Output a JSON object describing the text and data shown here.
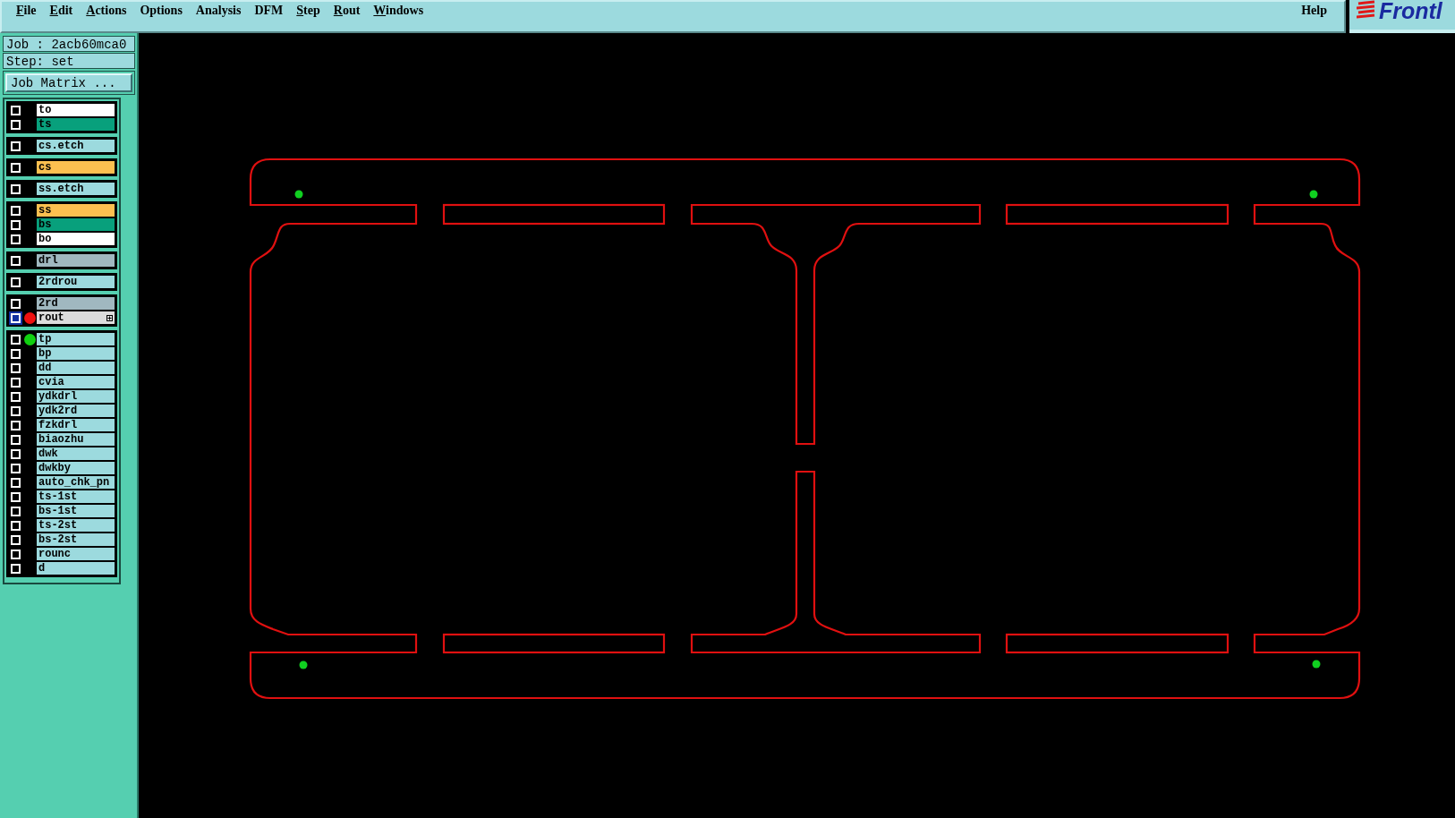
{
  "menu_bar": {
    "items": [
      {
        "label": "File",
        "mnemonic": true
      },
      {
        "label": "Edit",
        "mnemonic": true
      },
      {
        "label": "Actions",
        "mnemonic": true
      },
      {
        "label": "Options",
        "mnemonic": false
      },
      {
        "label": "Analysis",
        "mnemonic": false
      },
      {
        "label": "DFM",
        "mnemonic": false
      },
      {
        "label": "Step",
        "mnemonic": true
      },
      {
        "label": "Rout",
        "mnemonic": true
      },
      {
        "label": "Windows",
        "mnemonic": true
      }
    ],
    "help": "Help",
    "logo": "Frontl"
  },
  "job_panel": {
    "job": "Job : 2acb60mca0",
    "step": "Step: set",
    "job_matrix_button": "Job Matrix ..."
  },
  "layer_groups": [
    {
      "layers": [
        {
          "name": "to",
          "color": "#ffffff",
          "selected": false,
          "work_layer": false,
          "affected": false
        },
        {
          "name": "ts",
          "color": "#08a07c",
          "selected": false,
          "work_layer": false,
          "affected": false
        }
      ]
    },
    {
      "layers": [
        {
          "name": "cs.etch",
          "color": "#9cdade",
          "selected": false,
          "work_layer": false,
          "affected": false
        }
      ]
    },
    {
      "layers": [
        {
          "name": "cs",
          "color": "#fcc050",
          "selected": false,
          "work_layer": false,
          "affected": false
        }
      ]
    },
    {
      "layers": [
        {
          "name": "ss.etch",
          "color": "#9cdade",
          "selected": false,
          "work_layer": false,
          "affected": false
        }
      ]
    },
    {
      "layers": [
        {
          "name": "ss",
          "color": "#fcc050",
          "selected": false,
          "work_layer": false,
          "affected": false
        },
        {
          "name": "bs",
          "color": "#08a07c",
          "selected": false,
          "work_layer": false,
          "affected": false
        },
        {
          "name": "bo",
          "color": "#ffffff",
          "selected": false,
          "work_layer": false,
          "affected": false
        }
      ]
    },
    {
      "layers": [
        {
          "name": "drl",
          "color": "#a0b8c0",
          "selected": false,
          "work_layer": false,
          "affected": false
        }
      ]
    },
    {
      "layers": [
        {
          "name": "2rdrou",
          "color": "#9cdade",
          "selected": false,
          "work_layer": false,
          "affected": false
        }
      ]
    },
    {
      "layers": [
        {
          "name": "2rd",
          "color": "#a0b8c0",
          "selected": false,
          "work_layer": false,
          "affected": false
        },
        {
          "name": "rout",
          "color": "#dcdcdc",
          "selected": true,
          "work_layer": true,
          "affected": false
        }
      ]
    },
    {
      "layers": [
        {
          "name": "tp",
          "color": "#9cdade",
          "selected": false,
          "work_layer": false,
          "affected": true
        },
        {
          "name": "bp",
          "color": "#9cdade",
          "selected": false,
          "work_layer": false,
          "affected": false
        },
        {
          "name": "dd",
          "color": "#9cdade",
          "selected": false,
          "work_layer": false,
          "affected": false
        },
        {
          "name": "cvia",
          "color": "#9cdade",
          "selected": false,
          "work_layer": false,
          "affected": false
        },
        {
          "name": "ydkdrl",
          "color": "#9cdade",
          "selected": false,
          "work_layer": false,
          "affected": false
        },
        {
          "name": "ydk2rd",
          "color": "#9cdade",
          "selected": false,
          "work_layer": false,
          "affected": false
        },
        {
          "name": "fzkdrl",
          "color": "#9cdade",
          "selected": false,
          "work_layer": false,
          "affected": false
        },
        {
          "name": "biaozhu",
          "color": "#9cdade",
          "selected": false,
          "work_layer": false,
          "affected": false
        },
        {
          "name": "dwk",
          "color": "#9cdade",
          "selected": false,
          "work_layer": false,
          "affected": false
        },
        {
          "name": "dwkby",
          "color": "#9cdade",
          "selected": false,
          "work_layer": false,
          "affected": false
        },
        {
          "name": "auto_chk_pn",
          "color": "#9cdade",
          "selected": false,
          "work_layer": false,
          "affected": false
        },
        {
          "name": "ts-1st",
          "color": "#9cdade",
          "selected": false,
          "work_layer": false,
          "affected": false
        },
        {
          "name": "bs-1st",
          "color": "#9cdade",
          "selected": false,
          "work_layer": false,
          "affected": false
        },
        {
          "name": "ts-2st",
          "color": "#9cdade",
          "selected": false,
          "work_layer": false,
          "affected": false
        },
        {
          "name": "bs-2st",
          "color": "#9cdade",
          "selected": false,
          "work_layer": false,
          "affected": false
        },
        {
          "name": "rounc",
          "color": "#9cdade",
          "selected": false,
          "work_layer": false,
          "affected": false
        },
        {
          "name": "d",
          "color": "#9cdade",
          "selected": false,
          "work_layer": false,
          "affected": false
        }
      ]
    }
  ]
}
